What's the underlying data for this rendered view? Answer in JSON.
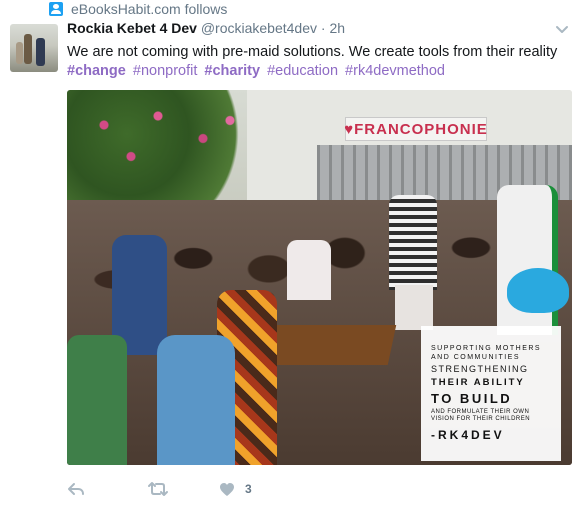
{
  "context": {
    "follows_label": "eBooksHabit.com follows"
  },
  "tweet": {
    "display_name": "Rockia Kebet 4 Dev",
    "handle": "@rockiakebet4dev",
    "separator": "·",
    "time": "2h",
    "text": "We are not coming with pre-maid solutions. We create tools from their reality",
    "hashtags": [
      {
        "text": "#change",
        "bold": true
      },
      {
        "text": "#nonprofit",
        "bold": false
      },
      {
        "text": "#charity",
        "bold": true
      },
      {
        "text": "#education",
        "bold": false
      },
      {
        "text": "#rk4devmethod",
        "bold": false
      }
    ]
  },
  "media": {
    "banner_text": "♥FRANCOPHONIE",
    "overlay_lines": [
      "SUPPORTING MOTHERS",
      "AND COMMUNITIES",
      "STRENGTHENING",
      "THEIR ABILITY",
      "TO BUILD",
      "AND FORMULATE THEIR OWN",
      "VISION FOR THEIR CHILDREN",
      "-RK4DEV"
    ]
  },
  "actions": {
    "like_count": "3"
  },
  "colors": {
    "hashtag": "#8e6bc4",
    "action_icon": "#aab8c2",
    "follows_icon": "#1da1f2"
  },
  "icons": [
    "follows-icon",
    "chevron-down-icon",
    "reply-icon",
    "retweet-icon",
    "heart-icon"
  ]
}
